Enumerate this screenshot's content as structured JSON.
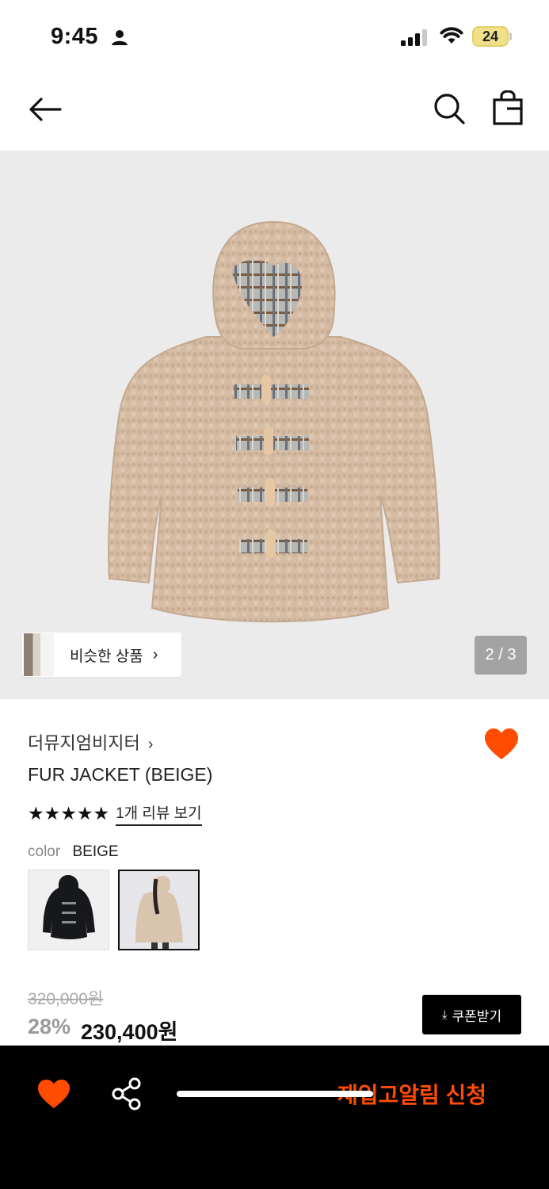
{
  "status": {
    "time": "9:45",
    "battery": "24"
  },
  "product_image": {
    "similar_label": "비슷한 상품",
    "page_indicator": "2 / 3"
  },
  "product": {
    "brand": "더뮤지엄비지터",
    "name": "FUR JACKET (BEIGE)",
    "rating_stars": 5,
    "stars_text": "★★★★★",
    "review_link": "1개 리뷰 보기",
    "color_label": "color",
    "color_value": "BEIGE",
    "original_price": "320,000원",
    "discount": "28%",
    "sale_price": "230,400원",
    "coupon_label": "쿠폰받기"
  },
  "bottom_bar": {
    "restock_label": "재입고알림 신청"
  },
  "colors": {
    "accent": "#ff4c00",
    "hero_bg": "#ebebeb",
    "bottom_bg": "#000000"
  }
}
